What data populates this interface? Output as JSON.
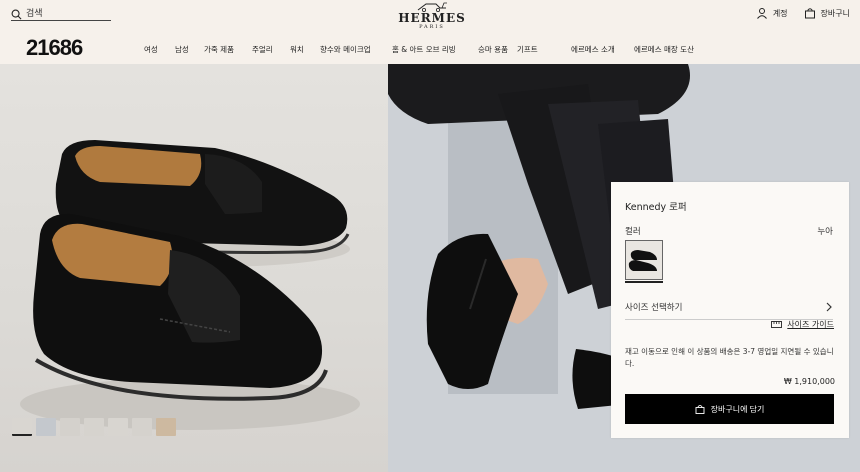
{
  "header": {
    "search_label": "검색",
    "brand": "HERMES",
    "brand_city": "PARIS",
    "account_label": "계정",
    "cart_label": "장바구니"
  },
  "overlay_code": "21686",
  "nav": {
    "items": [
      "여성",
      "남성",
      "가죽 제품",
      "주얼리",
      "워치",
      "향수와 메이크업",
      "홈 & 아트 오브 리빙",
      "승마 용품",
      "기프트",
      "에르메스 소개",
      "에르메스 매장 도산"
    ]
  },
  "product": {
    "name": "Kennedy 로퍼",
    "color_label": "컬러",
    "color_value": "누아",
    "size_select": "사이즈 선택하기",
    "size_guide": "사이즈 가이드",
    "notice": "재고 이동으로 인해 이 상품의 배송은 3-7 영업일 지연될 수 있습니다.",
    "price": "₩ 1,910,000",
    "add_to_cart": "장바구니에 담기"
  },
  "colors": {
    "background": "#f6f1eb",
    "button": "#000000",
    "shoe": "#121212"
  }
}
